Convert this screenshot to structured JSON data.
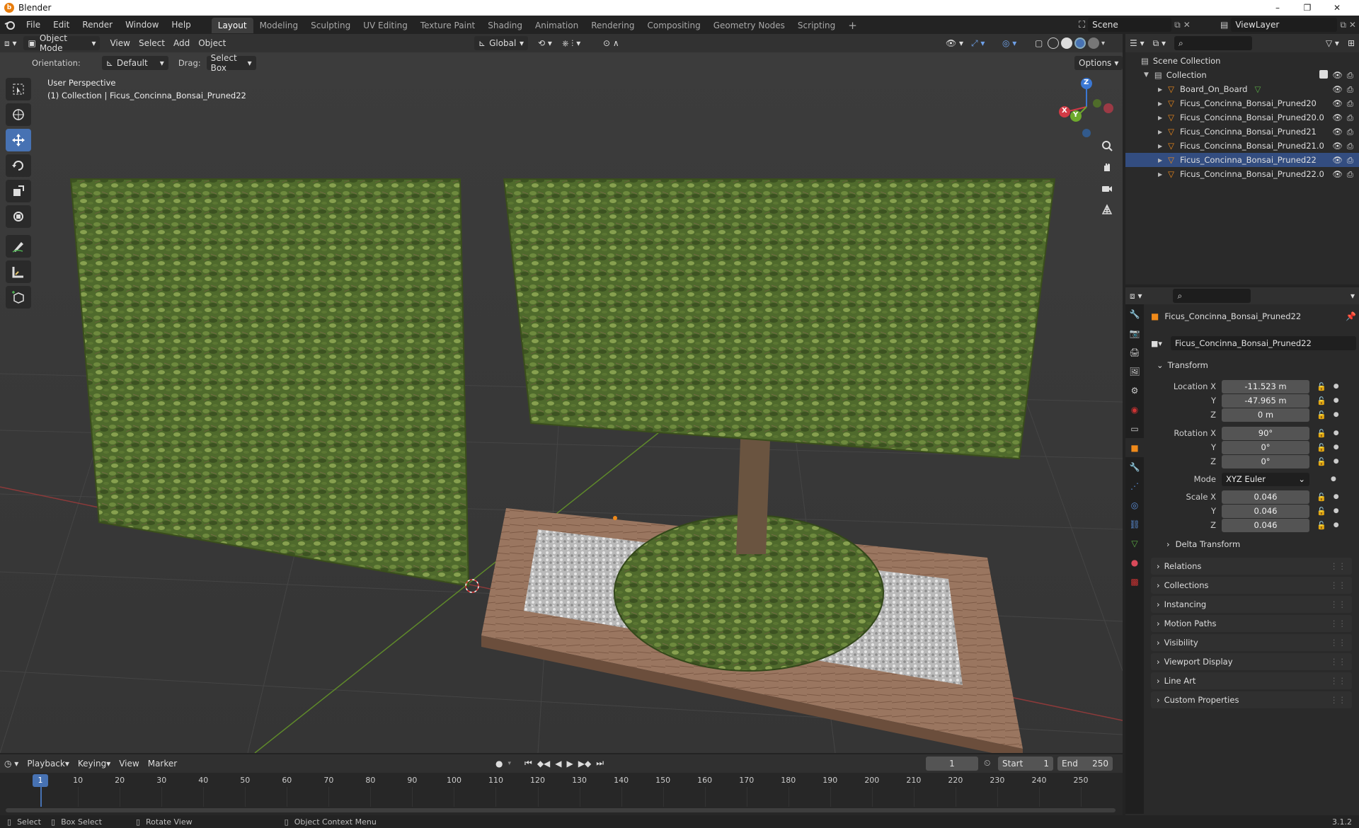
{
  "window": {
    "title": "Blender",
    "minimize": "–",
    "maximize": "❐",
    "close": "✕"
  },
  "menubar": {
    "menus": [
      "File",
      "Edit",
      "Render",
      "Window",
      "Help"
    ],
    "workspaces": [
      "Layout",
      "Modeling",
      "Sculpting",
      "UV Editing",
      "Texture Paint",
      "Shading",
      "Animation",
      "Rendering",
      "Compositing",
      "Geometry Nodes",
      "Scripting"
    ],
    "active_workspace": "Layout",
    "add_workspace": "+",
    "scene": "Scene",
    "view_layer": "ViewLayer"
  },
  "viewport_header": {
    "mode": "Object Mode",
    "menus": [
      "View",
      "Select",
      "Add",
      "Object"
    ],
    "transform_orientation": "Global",
    "orientation_label": "Orientation:",
    "orientation_value": "Default",
    "drag_label": "Drag:",
    "drag_value": "Select Box",
    "options": "Options"
  },
  "viewport": {
    "perspective": "User Perspective",
    "context": "(1) Collection | Ficus_Concinna_Bonsai_Pruned22",
    "gizmo_axes": [
      "X",
      "Y",
      "Z"
    ]
  },
  "outliner": {
    "root": "Scene Collection",
    "collection": "Collection",
    "objects": [
      "Board_On_Board",
      "Ficus_Concinna_Bonsai_Pruned20",
      "Ficus_Concinna_Bonsai_Pruned20.0",
      "Ficus_Concinna_Bonsai_Pruned21",
      "Ficus_Concinna_Bonsai_Pruned21.0",
      "Ficus_Concinna_Bonsai_Pruned22",
      "Ficus_Concinna_Bonsai_Pruned22.0"
    ],
    "selected_index": 5
  },
  "properties": {
    "object_name": "Ficus_Concinna_Bonsai_Pruned22",
    "object_field": "Ficus_Concinna_Bonsai_Pruned22",
    "transform_title": "Transform",
    "location_label": "Location X",
    "location": [
      "-11.523 m",
      "-47.965 m",
      "0 m"
    ],
    "rotation_label": "Rotation X",
    "rotation": [
      "90°",
      "0°",
      "0°"
    ],
    "mode_label": "Mode",
    "mode_value": "XYZ Euler",
    "scale_label": "Scale X",
    "scale": [
      "0.046",
      "0.046",
      "0.046"
    ],
    "axis_y": "Y",
    "axis_z": "Z",
    "delta_transform": "Delta Transform",
    "panels": [
      "Relations",
      "Collections",
      "Instancing",
      "Motion Paths",
      "Visibility",
      "Viewport Display",
      "Line Art",
      "Custom Properties"
    ]
  },
  "timeline": {
    "menus": [
      "Playback",
      "Keying",
      "View",
      "Marker"
    ],
    "current_frame": "1",
    "start_label": "Start",
    "start": "1",
    "end_label": "End",
    "end": "250",
    "ticks": [
      "10",
      "20",
      "30",
      "40",
      "50",
      "60",
      "70",
      "80",
      "90",
      "100",
      "110",
      "120",
      "130",
      "140",
      "150",
      "160",
      "170",
      "180",
      "190",
      "200",
      "210",
      "220",
      "230",
      "240",
      "250"
    ],
    "playhead": "1"
  },
  "statusbar": {
    "items": [
      "Select",
      "Box Select",
      "Rotate View",
      "Object Context Menu"
    ],
    "version": "3.1.2"
  }
}
